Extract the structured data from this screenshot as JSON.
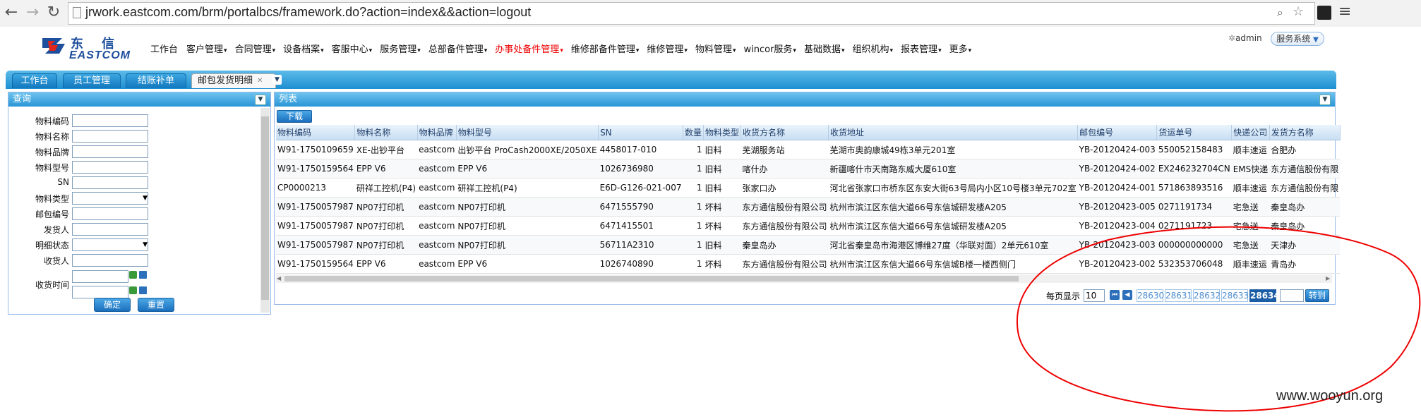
{
  "browser": {
    "url": "jrwork.eastcom.com/brm/portalbcs/framework.do?action=index&&action=logout"
  },
  "header": {
    "logo_cn": "东信",
    "logo_en": "EASTCOM",
    "menu": [
      {
        "label": "工作台",
        "hot": false,
        "arrow": false
      },
      {
        "label": "客户管理",
        "hot": false,
        "arrow": true
      },
      {
        "label": "合同管理",
        "hot": false,
        "arrow": true
      },
      {
        "label": "设备档案",
        "hot": false,
        "arrow": true
      },
      {
        "label": "客服中心",
        "hot": false,
        "arrow": true
      },
      {
        "label": "服务管理",
        "hot": false,
        "arrow": true
      },
      {
        "label": "总部备件管理",
        "hot": false,
        "arrow": true
      },
      {
        "label": "办事处备件管理",
        "hot": true,
        "arrow": true
      },
      {
        "label": "维修部备件管理",
        "hot": false,
        "arrow": true
      },
      {
        "label": "维修管理",
        "hot": false,
        "arrow": true
      },
      {
        "label": "物料管理",
        "hot": false,
        "arrow": true
      },
      {
        "label": "wincor服务",
        "hot": false,
        "arrow": true
      },
      {
        "label": "基础数据",
        "hot": false,
        "arrow": true
      },
      {
        "label": "组织机构",
        "hot": false,
        "arrow": true
      },
      {
        "label": "报表管理",
        "hot": false,
        "arrow": true
      },
      {
        "label": "更多",
        "hot": false,
        "arrow": true
      }
    ],
    "user": "admin",
    "service_system": "服务系统"
  },
  "tabs": [
    "工作台",
    "员工管理",
    "结账补单",
    "邮包发货明细"
  ],
  "query": {
    "title": "查询",
    "fields": [
      "物料编码",
      "物料名称",
      "物料品牌",
      "物料型号",
      "SN",
      "物料类型",
      "邮包编号",
      "发货人",
      "明细状态",
      "收货人",
      "收货时间"
    ],
    "confirm": "确定",
    "reset": "重置"
  },
  "list": {
    "title": "列表",
    "download": "下载",
    "columns": [
      "物料编码",
      "物料名称",
      "物料品牌",
      "物料型号",
      "SN",
      "数量",
      "物料类型",
      "收货方名称",
      "收货地址",
      "邮包编号",
      "货运单号",
      "快递公司",
      "发货方名称"
    ],
    "rows": [
      [
        "W91-1750109659",
        "XE-出钞平台",
        "eastcom",
        "出钞平台 ProCash2000XE/2050XE",
        "4458017-010",
        "1",
        "旧料",
        "芜湖服务站",
        "芜湖市奥韵康城49栋3单元201室",
        "YB-20120424-003",
        "550052158483",
        "顺丰速运",
        "合肥办"
      ],
      [
        "W91-1750159564",
        "EPP V6",
        "eastcom",
        "EPP V6",
        "1026736980",
        "1",
        "旧料",
        "喀什办",
        "新疆喀什市天南路东威大厦610室",
        "YB-20120424-002",
        "EX246232704CN",
        "EMS快递",
        "东方通信股份有限"
      ],
      [
        "CP0000213",
        "研祥工控机(P4)",
        "eastcom",
        "研祥工控机(P4)",
        "E6D-G126-021-007",
        "1",
        "旧料",
        "张家口办",
        "河北省张家口市桥东区东安大街63号局内小区10号楼3单元702室",
        "YB-20120424-001",
        "571863893516",
        "顺丰速运",
        "东方通信股份有限"
      ],
      [
        "W91-1750057987",
        "NP07打印机",
        "eastcom",
        "NP07打印机",
        "6471555790",
        "1",
        "坏料",
        "东方通信股份有限公司",
        "杭州市滨江区东信大道66号东信城研发楼A205",
        "YB-20120423-005",
        "0271191734",
        "宅急送",
        "秦皇岛办"
      ],
      [
        "W91-1750057987",
        "NP07打印机",
        "eastcom",
        "NP07打印机",
        "6471415501",
        "1",
        "坏料",
        "东方通信股份有限公司",
        "杭州市滨江区东信大道66号东信城研发楼A205",
        "YB-20120423-004",
        "0271191723",
        "宅急送",
        "秦皇岛办"
      ],
      [
        "W91-1750057987",
        "NP07打印机",
        "eastcom",
        "NP07打印机",
        "56711A2310",
        "1",
        "旧料",
        "秦皇岛办",
        "河北省秦皇岛市海港区博维27度（华联对面）2单元610室",
        "YB-20120423-003",
        "000000000000",
        "宅急送",
        "天津办"
      ],
      [
        "W91-1750159564",
        "EPP V6",
        "eastcom",
        "EPP V6",
        "1026740890",
        "1",
        "坏料",
        "东方通信股份有限公司",
        "杭州市滨江区东信大道66号东信城B楼一楼西侧门",
        "YB-20120423-002",
        "532353706048",
        "顺丰速运",
        "青岛办"
      ]
    ]
  },
  "pager": {
    "page_size_label": "每页显示",
    "page_size": "10",
    "pages": [
      "28630",
      "28631",
      "28632",
      "28633",
      "28634"
    ],
    "current_page": "28634",
    "goto_label": "转到"
  },
  "watermark": "www.wooyun.org",
  "colors": {
    "tab_bar": "#1e8fd2",
    "highlight_menu": "#e00000",
    "annotation": "#e00000"
  }
}
